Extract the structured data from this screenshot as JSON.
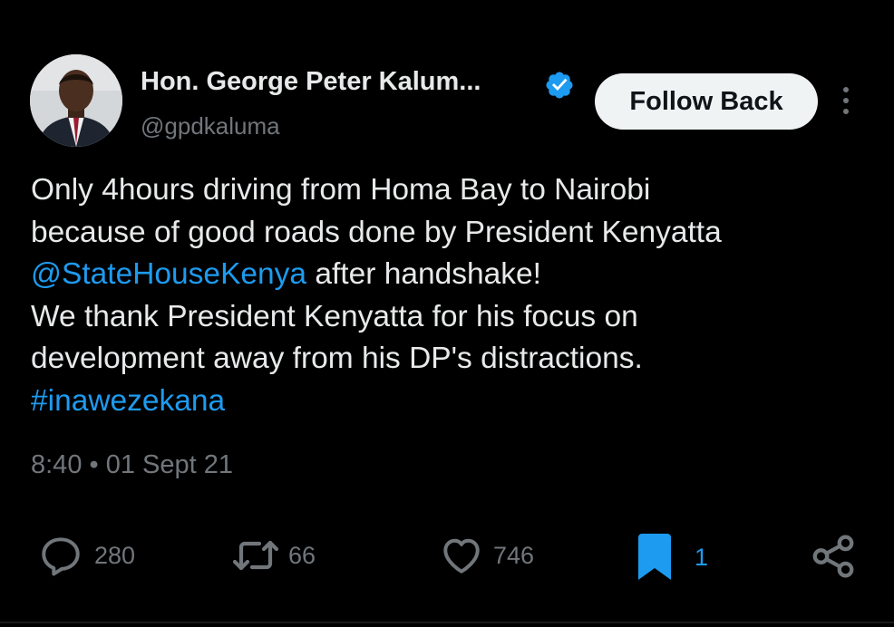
{
  "tweet": {
    "author_name": "Hon. George Peter Kalum...",
    "handle": "@gpdkaluma",
    "follow_button": "Follow Back",
    "text": {
      "line1": "Only 4hours driving from Homa Bay to Nairobi",
      "line2": "because of good roads done by President Kenyatta",
      "mention": "@StateHouseKenya",
      "line3_rest": " after handshake!",
      "line4": "We thank President Kenyatta for his focus on",
      "line5": "development away from his DP's distractions.",
      "hashtag": "#inawezekana"
    },
    "timestamp": "8:40 • 01 Sept 21"
  },
  "actions": {
    "replies": "280",
    "reposts": "66",
    "likes": "746",
    "bookmarks": "1"
  },
  "icons": [
    "verified-badge-icon",
    "more-icon",
    "reply-icon",
    "repost-icon",
    "like-icon",
    "bookmark-icon",
    "share-icon"
  ],
  "colors": {
    "background": "#000000",
    "text": "#e7e9ea",
    "muted": "#71767b",
    "accent": "#1d9bf0",
    "button_bg": "#eff3f4"
  }
}
